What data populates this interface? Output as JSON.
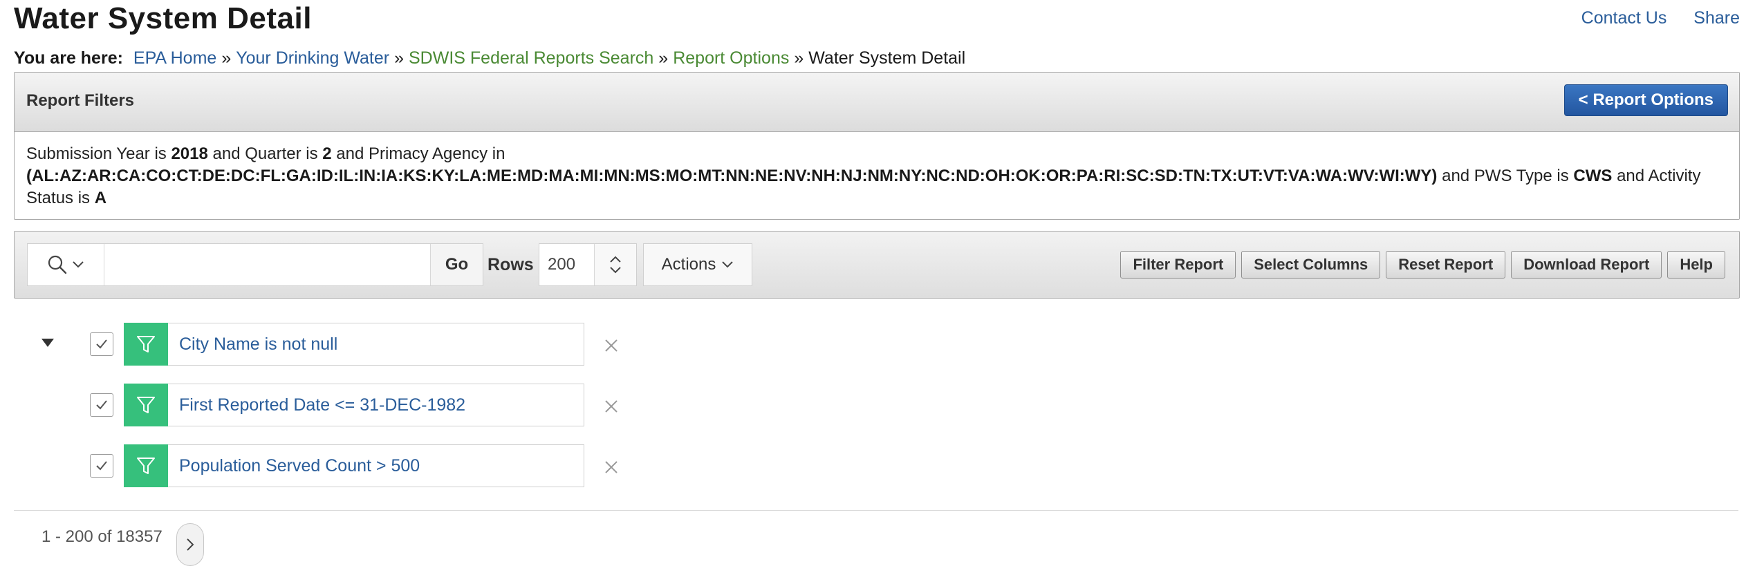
{
  "header": {
    "title": "Water System Detail",
    "contact_us": "Contact Us",
    "share": "Share"
  },
  "breadcrumb": {
    "label": "You are here:",
    "items": [
      {
        "label": "EPA Home",
        "color": "#2a5d9a"
      },
      {
        "label": "Your Drinking Water",
        "color": "#2a5d9a"
      },
      {
        "label": "SDWIS Federal Reports Search",
        "color": "#4a8a34"
      },
      {
        "label": "Report Options",
        "color": "#4a8a34"
      }
    ],
    "separator": "»",
    "current": "Water System Detail"
  },
  "report_filters": {
    "title": "Report Filters",
    "report_options_button": "< Report Options",
    "text": {
      "t1": "Submission Year is ",
      "year": "2018",
      "t2": " and Quarter is ",
      "quarter": "2",
      "t3": " and Primacy Agency in",
      "agencies": "(AL:AZ:AR:CA:CO:CT:DE:DC:FL:GA:ID:IL:IN:IA:KS:KY:LA:ME:MD:MA:MI:MN:MS:MO:MT:NN:NE:NV:NH:NJ:NM:NY:NC:ND:OH:OK:OR:PA:RI:SC:SD:TN:TX:UT:VT:VA:WA:WV:WI:WY)",
      "t4": " and PWS Type is ",
      "pws_type": "CWS",
      "t5": " and Activity Status is ",
      "status": "A"
    }
  },
  "toolbar": {
    "search_value": "",
    "go_label": "Go",
    "rows_label": "Rows",
    "rows_value": "200",
    "actions_label": "Actions",
    "buttons": {
      "filter_report": "Filter Report",
      "select_columns": "Select Columns",
      "reset_report": "Reset Report",
      "download_report": "Download Report",
      "help": "Help"
    }
  },
  "filters": [
    {
      "label": "City Name is not null",
      "checked": true
    },
    {
      "label": "First Reported Date <= 31-DEC-1982",
      "checked": true
    },
    {
      "label": "Population Served Count > 500",
      "checked": true
    }
  ],
  "pagination": {
    "text": "1 - 200 of 18357"
  },
  "colors": {
    "link_blue": "#2a5d9a",
    "link_green": "#4a8a34",
    "filter_green": "#36c07c",
    "primary_button": "#2d63ad"
  }
}
